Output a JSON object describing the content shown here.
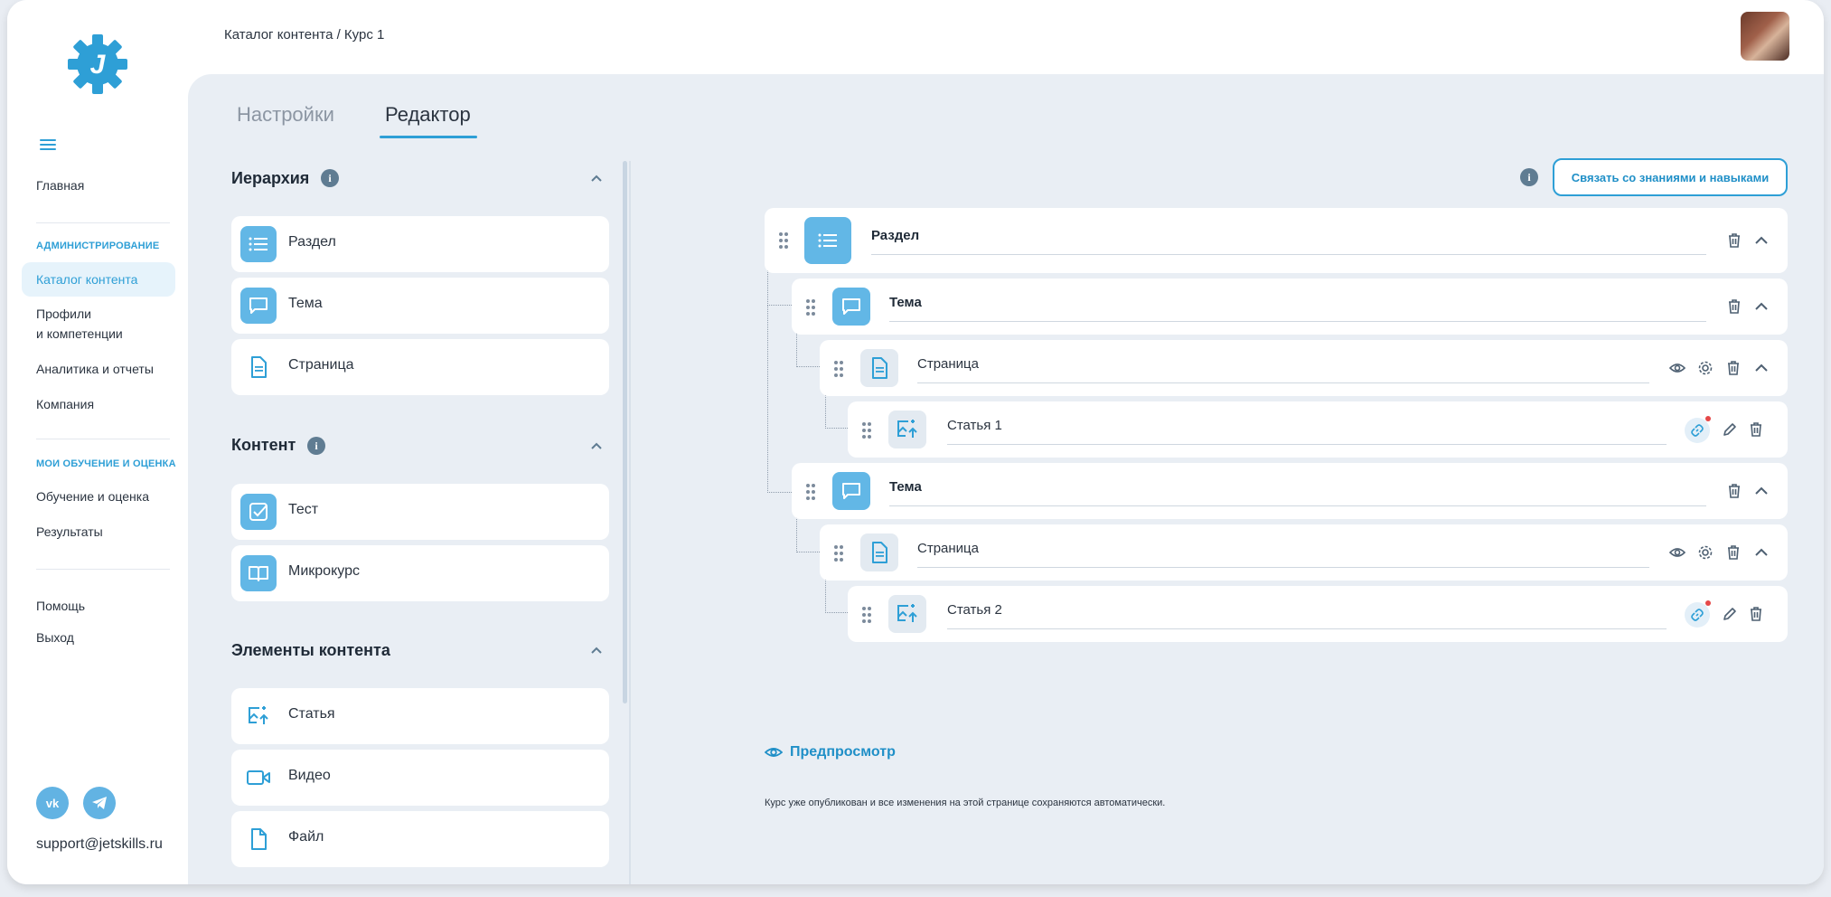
{
  "breadcrumb": "Каталог контента / Курс 1",
  "tabs": {
    "settings": "Настройки",
    "editor": "Редактор"
  },
  "sidebar": {
    "home": "Главная",
    "admin_section": "АДМИНИСТРИРОВАНИЕ",
    "catalog": "Каталог контента",
    "profiles_line1": "Профили",
    "profiles_line2": "и компетенции",
    "analytics": "Аналитика и отчеты",
    "company": "Компания",
    "learning_section": "МОИ ОБУЧЕНИЕ И ОЦЕНКА",
    "learning": "Обучение и оценка",
    "results": "Результаты",
    "help": "Помощь",
    "logout": "Выход",
    "support_email": "support@jetskills.ru"
  },
  "left_panel": {
    "hierarchy": {
      "title": "Иерархия",
      "items": [
        "Раздел",
        "Тема",
        "Страница"
      ]
    },
    "content": {
      "title": "Контент",
      "items": [
        "Тест",
        "Микрокурс"
      ]
    },
    "elements": {
      "title": "Элементы контента",
      "items": [
        "Статья",
        "Видео",
        "Файл"
      ]
    }
  },
  "tree": {
    "bind_button": "Связать со знаниями и навыками",
    "nodes": [
      {
        "level": 0,
        "type": "section",
        "value": "Раздел"
      },
      {
        "level": 1,
        "type": "topic",
        "value": "Тема"
      },
      {
        "level": 2,
        "type": "page",
        "value": "Страница"
      },
      {
        "level": 3,
        "type": "article",
        "value": "Статья 1"
      },
      {
        "level": 1,
        "type": "topic",
        "value": "Тема"
      },
      {
        "level": 2,
        "type": "page",
        "value": "Страница"
      },
      {
        "level": 3,
        "type": "article",
        "value": "Статья 2"
      }
    ],
    "preview": "Предпросмотр",
    "notice": "Курс уже опубликован и все изменения на этой странице сохраняются автоматически."
  },
  "colors": {
    "accent": "#2e9fd6",
    "icon_fill": "#62b7e6",
    "background": "#e9eef4",
    "badge": "#e54848"
  }
}
